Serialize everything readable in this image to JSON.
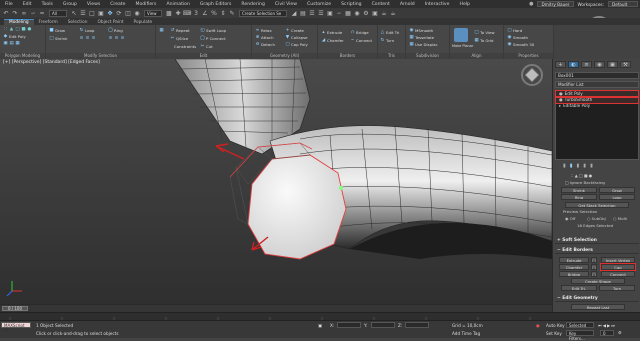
{
  "menubar": {
    "items": [
      "File",
      "Edit",
      "Tools",
      "Group",
      "Views",
      "Create",
      "Modifiers",
      "Animation",
      "Graph Editors",
      "Rendering",
      "Civil View",
      "Customize",
      "Scripting",
      "Content",
      "Arnold",
      "Interactive",
      "Help"
    ],
    "user": "Dmitry Bauer",
    "workspaces_label": "Workspaces:",
    "workspace_value": "Default"
  },
  "quick_toolbar": {
    "filter": "All",
    "view": "View",
    "selection_set": "Create Selection Se"
  },
  "ribbon": {
    "tabs": [
      "Modeling",
      "Freeform",
      "Selection",
      "Object Paint",
      "Populate"
    ],
    "groups": {
      "polygon_modeling": "Polygon Modeling",
      "modify_selection": "Modify Selection",
      "edit": "Edit",
      "geometry_all": "Geometry (All)",
      "borders": "Borders",
      "tris": "Tris",
      "subdivision": "Subdivision",
      "align": "Align",
      "properties": "Properties"
    },
    "buttons": {
      "edit_poly": "Edit Poly",
      "grow": "Grow",
      "shrink": "Shrink",
      "loop": "Loop",
      "ring": "Ring",
      "repeat": "Repeat",
      "quickslice": "QSlice",
      "swift_loop": "Swift Loop",
      "p_connect": "P Connect",
      "cut": "Cut",
      "constraints": "Constraints",
      "relax": "Relax",
      "create": "Create",
      "attach": "Attach",
      "collapse": "Collapse",
      "detach": "Detach",
      "cap_poly": "Cap Poly",
      "extrude": "Extrude",
      "bridge": "Bridge",
      "chamfer": "Chamfer",
      "connect": "Connect",
      "edit_tri": "Edit Tri",
      "turn": "Turn",
      "msmooth": "MSmooth",
      "tessellate": "Tessellate",
      "use_displace": "Use Displac",
      "make_planar": "Make Planar",
      "to_view": "To View",
      "to_grid": "To Grid",
      "hard": "Hard",
      "smooth": "Smooth",
      "smooth30": "Smooth 30"
    }
  },
  "viewport": {
    "label": "[+] [Perspective] [Standard] [Edged Faces]"
  },
  "command_panel": {
    "object_name": "Box001",
    "modifier_list": "Modifier List",
    "stack": [
      {
        "label": "Edit Poly",
        "selected": true
      },
      {
        "label": "TurboSmooth",
        "selected": true
      },
      {
        "label": "Editable Poly",
        "selected": false
      }
    ],
    "selection": {
      "ignore_backfacing": "Ignore Backfacing",
      "shrink": "Shrink",
      "grow": "Grow",
      "ring": "Ring",
      "loop": "Loop",
      "get_stack_selection": "Get Stack Selection",
      "preview_selection": "Preview Selection",
      "off": "Off",
      "subobj": "SubObj",
      "multi": "Multi",
      "status": "16 Edges Selected"
    },
    "soft_selection": "Soft Selection",
    "edit_borders": "Edit Borders",
    "borders": {
      "extrude": "Extrude",
      "insert_vertex": "Insert Vertex",
      "chamfer": "Chamfer",
      "cap": "Cap",
      "bridge": "Bridge",
      "connect": "Connect",
      "create_shape": "Create Shape",
      "edit_tri": "Edit Tri.",
      "turn": "Turn"
    },
    "edit_geometry": "Edit Geometry",
    "geometry": {
      "repeat_last": "Repeat Last",
      "constraints": "Constraints",
      "none": "None",
      "edge": "Edge",
      "face": "Face",
      "normal": "Normal"
    }
  },
  "timeline": {
    "frame": "0 / 100"
  },
  "status": {
    "script": "MAXScript Mi",
    "selected": "1 Object Selected",
    "prompt": "Click or click-and-drag to select objects",
    "x_label": "X:",
    "y_label": "Y:",
    "z_label": "Z:",
    "grid": "Grid = 10,0cm",
    "add_time_tag": "Add Time Tag",
    "auto_key": "Auto Key",
    "selected_mode": "Selected",
    "set_key": "Set Key",
    "key_filters": "Key Filters...",
    "frame_value": "0"
  }
}
